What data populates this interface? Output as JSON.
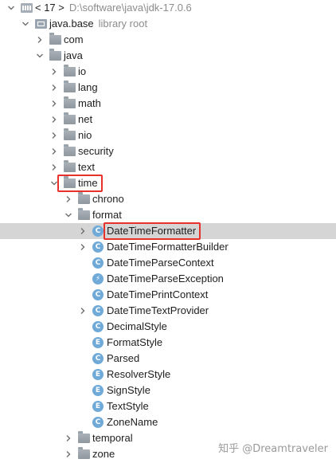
{
  "tree": [
    {
      "label": "< 17 >",
      "hint": "D:\\software\\java\\jdk-17.0.6",
      "depth": 0,
      "expanded": true,
      "icon": "lib-icon",
      "name": "tree-node-jdk-17"
    },
    {
      "label": "java.base",
      "hint": "library root",
      "depth": 1,
      "expanded": true,
      "icon": "module-icon",
      "name": "tree-node-java-base"
    },
    {
      "label": "com",
      "depth": 2,
      "expanded": false,
      "icon": "folder-icon",
      "name": "tree-node-com"
    },
    {
      "label": "java",
      "depth": 2,
      "expanded": true,
      "icon": "folder-icon",
      "name": "tree-node-java"
    },
    {
      "label": "io",
      "depth": 3,
      "expanded": false,
      "icon": "folder-icon",
      "name": "tree-node-io"
    },
    {
      "label": "lang",
      "depth": 3,
      "expanded": false,
      "icon": "folder-icon",
      "name": "tree-node-lang"
    },
    {
      "label": "math",
      "depth": 3,
      "expanded": false,
      "icon": "folder-icon",
      "name": "tree-node-math"
    },
    {
      "label": "net",
      "depth": 3,
      "expanded": false,
      "icon": "folder-icon",
      "name": "tree-node-net"
    },
    {
      "label": "nio",
      "depth": 3,
      "expanded": false,
      "icon": "folder-icon",
      "name": "tree-node-nio"
    },
    {
      "label": "security",
      "depth": 3,
      "expanded": false,
      "icon": "folder-icon",
      "name": "tree-node-security"
    },
    {
      "label": "text",
      "depth": 3,
      "expanded": false,
      "icon": "folder-icon",
      "name": "tree-node-text"
    },
    {
      "label": "time",
      "depth": 3,
      "expanded": true,
      "icon": "folder-icon",
      "name": "tree-node-time",
      "highlight": true
    },
    {
      "label": "chrono",
      "depth": 4,
      "expanded": false,
      "icon": "folder-icon",
      "name": "tree-node-chrono"
    },
    {
      "label": "format",
      "depth": 4,
      "expanded": true,
      "icon": "folder-icon",
      "name": "tree-node-format"
    },
    {
      "label": "DateTimeFormatter",
      "depth": 5,
      "expanded": false,
      "icon": "class-icon",
      "badge": "C",
      "name": "tree-node-datetimeformatter",
      "selected": true,
      "highlight": true
    },
    {
      "label": "DateTimeFormatterBuilder",
      "depth": 5,
      "expanded": false,
      "icon": "class-icon",
      "badge": "C",
      "name": "tree-node-datetimeformatterbuilder"
    },
    {
      "label": "DateTimeParseContext",
      "depth": 5,
      "leaf": true,
      "icon": "class-icon",
      "badge": "C",
      "name": "tree-node-datetimeparsecontext"
    },
    {
      "label": "DateTimeParseException",
      "depth": 5,
      "leaf": true,
      "icon": "exception-icon",
      "badge": "⚡",
      "name": "tree-node-datetimeparseexception"
    },
    {
      "label": "DateTimePrintContext",
      "depth": 5,
      "leaf": true,
      "icon": "class-icon",
      "badge": "C",
      "name": "tree-node-datetimeprintcontext"
    },
    {
      "label": "DateTimeTextProvider",
      "depth": 5,
      "expanded": false,
      "icon": "class-icon",
      "badge": "C",
      "name": "tree-node-datetimetextprovider"
    },
    {
      "label": "DecimalStyle",
      "depth": 5,
      "leaf": true,
      "icon": "class-icon",
      "badge": "C",
      "name": "tree-node-decimalstyle"
    },
    {
      "label": "FormatStyle",
      "depth": 5,
      "leaf": true,
      "icon": "enum-icon",
      "badge": "E",
      "name": "tree-node-formatstyle"
    },
    {
      "label": "Parsed",
      "depth": 5,
      "leaf": true,
      "icon": "class-icon",
      "badge": "C",
      "name": "tree-node-parsed"
    },
    {
      "label": "ResolverStyle",
      "depth": 5,
      "leaf": true,
      "icon": "enum-icon",
      "badge": "E",
      "name": "tree-node-resolverstyle"
    },
    {
      "label": "SignStyle",
      "depth": 5,
      "leaf": true,
      "icon": "enum-icon",
      "badge": "E",
      "name": "tree-node-signstyle"
    },
    {
      "label": "TextStyle",
      "depth": 5,
      "leaf": true,
      "icon": "enum-icon",
      "badge": "E",
      "name": "tree-node-textstyle"
    },
    {
      "label": "ZoneName",
      "depth": 5,
      "leaf": true,
      "icon": "class-icon",
      "badge": "C",
      "name": "tree-node-zonename"
    },
    {
      "label": "temporal",
      "depth": 4,
      "expanded": false,
      "icon": "folder-icon",
      "name": "tree-node-temporal"
    },
    {
      "label": "zone",
      "depth": 4,
      "expanded": false,
      "icon": "folder-icon",
      "name": "tree-node-zone"
    }
  ],
  "watermark": "知乎 @Dreamtraveler",
  "colors": {
    "selection": "#d5d5d5",
    "highlight_box": "#e8312b",
    "class_badge": "#6faad8",
    "folder": "#9aa2aa"
  }
}
